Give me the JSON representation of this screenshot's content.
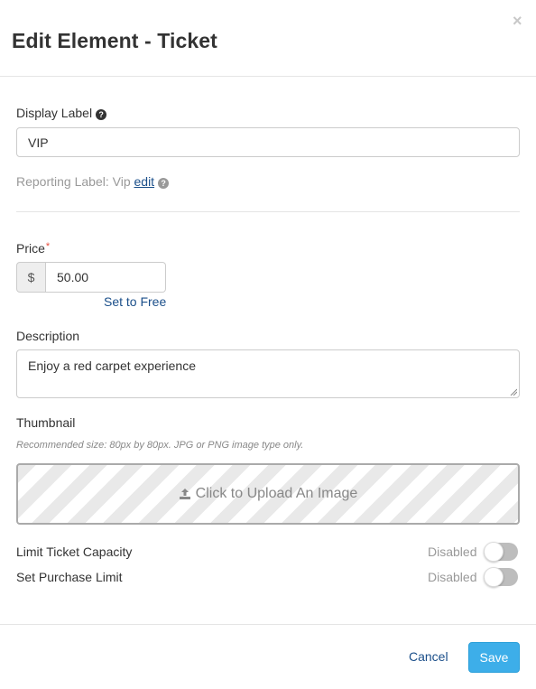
{
  "modal": {
    "title": "Edit Element - Ticket",
    "close_glyph": "×"
  },
  "display_label": {
    "label": "Display Label",
    "help_icon": "question-circle-icon",
    "value": "VIP"
  },
  "reporting_label": {
    "prefix": "Reporting Label: Vip",
    "edit_link": "edit",
    "help_icon": "question-circle-icon"
  },
  "price": {
    "label": "Price",
    "required_mark": "*",
    "currency": "$",
    "value": "50.00",
    "set_free_link": "Set to Free"
  },
  "description": {
    "label": "Description",
    "value": "Enjoy a red carpet experience"
  },
  "thumbnail": {
    "label": "Thumbnail",
    "hint": "Recommended size: 80px by 80px. JPG or PNG image type only.",
    "upload_icon": "upload-icon",
    "upload_text": "Click to Upload An Image"
  },
  "limit_capacity": {
    "label": "Limit Ticket Capacity",
    "status": "Disabled",
    "enabled": false
  },
  "purchase_limit": {
    "label": "Set Purchase Limit",
    "status": "Disabled",
    "enabled": false
  },
  "footer": {
    "cancel_label": "Cancel",
    "save_label": "Save"
  },
  "colors": {
    "primary_button": "#3daee9",
    "link": "#1b4f8a",
    "required": "#e74c3c"
  }
}
